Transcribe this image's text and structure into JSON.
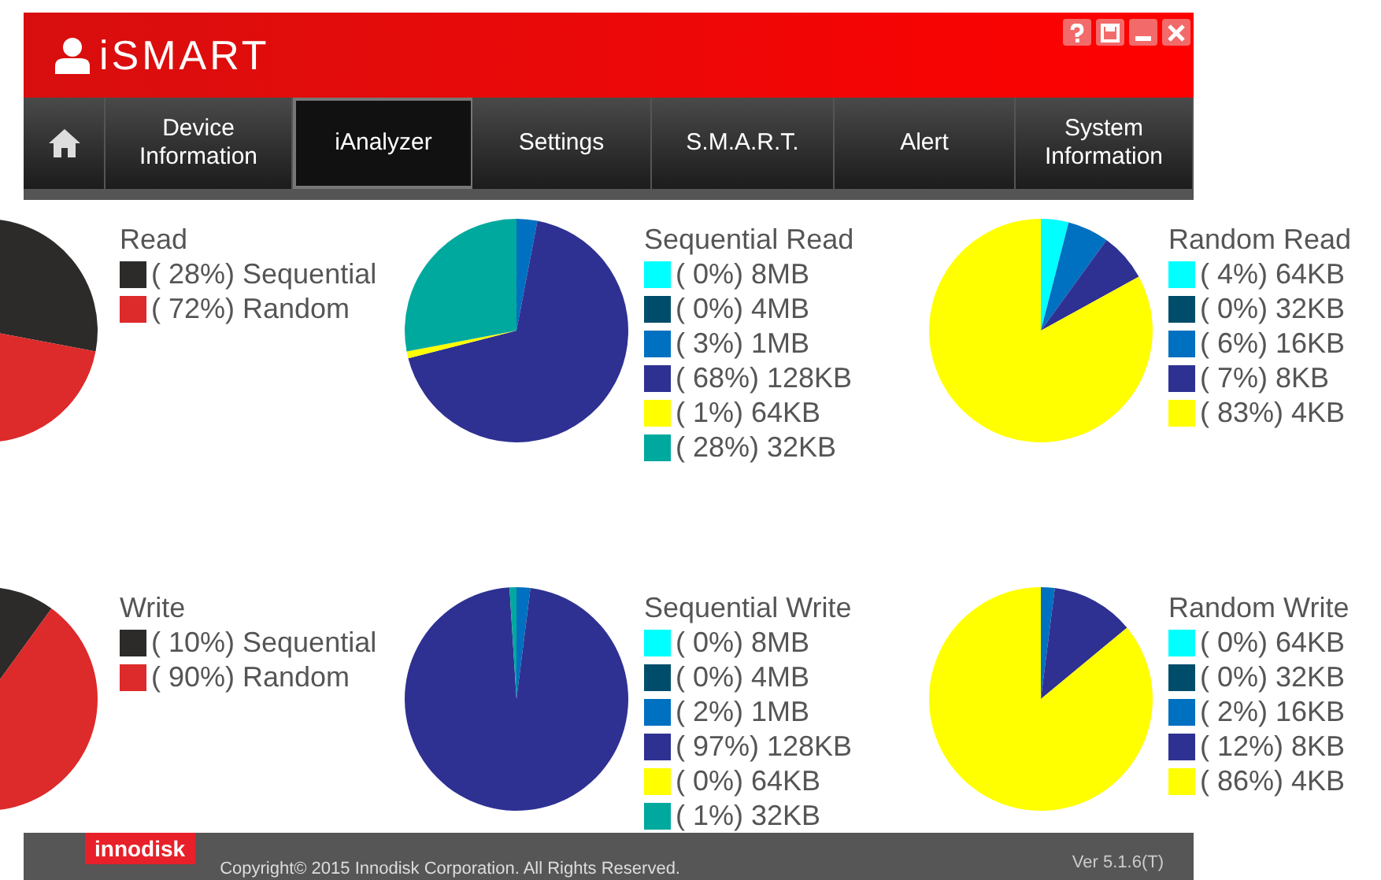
{
  "app": {
    "title": "iSMART"
  },
  "tabs": [
    {
      "kind": "home",
      "selected": false
    },
    {
      "kind": "text",
      "label": "Device Information",
      "selected": false
    },
    {
      "kind": "text",
      "label": "iAnalyzer",
      "selected": true
    },
    {
      "kind": "text",
      "label": "Settings",
      "selected": false
    },
    {
      "kind": "text",
      "label": "S.M.A.R.T.",
      "selected": false
    },
    {
      "kind": "text",
      "label": "Alert",
      "selected": false
    },
    {
      "kind": "text",
      "label": "System Information",
      "selected": false
    }
  ],
  "charts": [
    {
      "legend": [
        {
          "percent": "( 28%)",
          "color": "#2d2a2a"
        },
        {
          "percent": "( 72%)",
          "color": "#dd2a2a"
        }
      ],
      "chart_data": {
        "type": "pie",
        "title": "Read",
        "categories": [
          "Sequential",
          "Random"
        ],
        "values": [
          28,
          72
        ]
      }
    },
    {
      "legend": [
        {
          "percent": "( 0%)",
          "color": "#00ffff"
        },
        {
          "percent": "( 0%)",
          "color": "#004d6b"
        },
        {
          "percent": "( 3%)",
          "color": "#0070c0"
        },
        {
          "percent": "( 68%)",
          "color": "#2e3192"
        },
        {
          "percent": "( 1%)",
          "color": "#ffff00"
        },
        {
          "percent": "( 28%)",
          "color": "#00a99d"
        }
      ],
      "chart_data": {
        "type": "pie",
        "title": "Sequential Read",
        "categories": [
          "8MB",
          "4MB",
          "1MB",
          "128KB",
          "64KB",
          "32KB"
        ],
        "values": [
          0,
          0,
          3,
          68,
          1,
          28
        ]
      }
    },
    {
      "legend": [
        {
          "percent": "( 4%)",
          "color": "#00ffff"
        },
        {
          "percent": "( 0%)",
          "color": "#004d6b"
        },
        {
          "percent": "( 6%)",
          "color": "#0070c0"
        },
        {
          "percent": "( 7%)",
          "color": "#2e3192"
        },
        {
          "percent": "( 83%)",
          "color": "#ffff00"
        }
      ],
      "chart_data": {
        "type": "pie",
        "title": "Random Read",
        "categories": [
          "64KB",
          "32KB",
          "16KB",
          "8KB",
          "4KB"
        ],
        "values": [
          4,
          0,
          6,
          7,
          83
        ]
      }
    },
    {
      "legend": [
        {
          "percent": "( 10%)",
          "color": "#2d2a2a"
        },
        {
          "percent": "( 90%)",
          "color": "#dd2a2a"
        }
      ],
      "chart_data": {
        "type": "pie",
        "title": "Write",
        "categories": [
          "Sequential",
          "Random"
        ],
        "values": [
          10,
          90
        ]
      }
    },
    {
      "legend": [
        {
          "percent": "( 0%)",
          "color": "#00ffff"
        },
        {
          "percent": "( 0%)",
          "color": "#004d6b"
        },
        {
          "percent": "( 2%)",
          "color": "#0070c0"
        },
        {
          "percent": "( 97%)",
          "color": "#2e3192"
        },
        {
          "percent": "( 0%)",
          "color": "#ffff00"
        },
        {
          "percent": "( 1%)",
          "color": "#00a99d"
        }
      ],
      "chart_data": {
        "type": "pie",
        "title": "Sequential Write",
        "categories": [
          "8MB",
          "4MB",
          "1MB",
          "128KB",
          "64KB",
          "32KB"
        ],
        "values": [
          0,
          0,
          2,
          97,
          0,
          1
        ]
      }
    },
    {
      "legend": [
        {
          "percent": "( 0%)",
          "color": "#00ffff"
        },
        {
          "percent": "( 0%)",
          "color": "#004d6b"
        },
        {
          "percent": "( 2%)",
          "color": "#0070c0"
        },
        {
          "percent": "( 12%)",
          "color": "#2e3192"
        },
        {
          "percent": "( 86%)",
          "color": "#ffff00"
        }
      ],
      "chart_data": {
        "type": "pie",
        "title": "Random Write",
        "categories": [
          "64KB",
          "32KB",
          "16KB",
          "8KB",
          "4KB"
        ],
        "values": [
          0,
          0,
          2,
          12,
          86
        ]
      }
    }
  ],
  "footer": {
    "brand": "innodisk",
    "copyright": "Copyright© 2015 Innodisk Corporation. All Rights Reserved.",
    "version": "Ver 5.1.6(T)"
  }
}
